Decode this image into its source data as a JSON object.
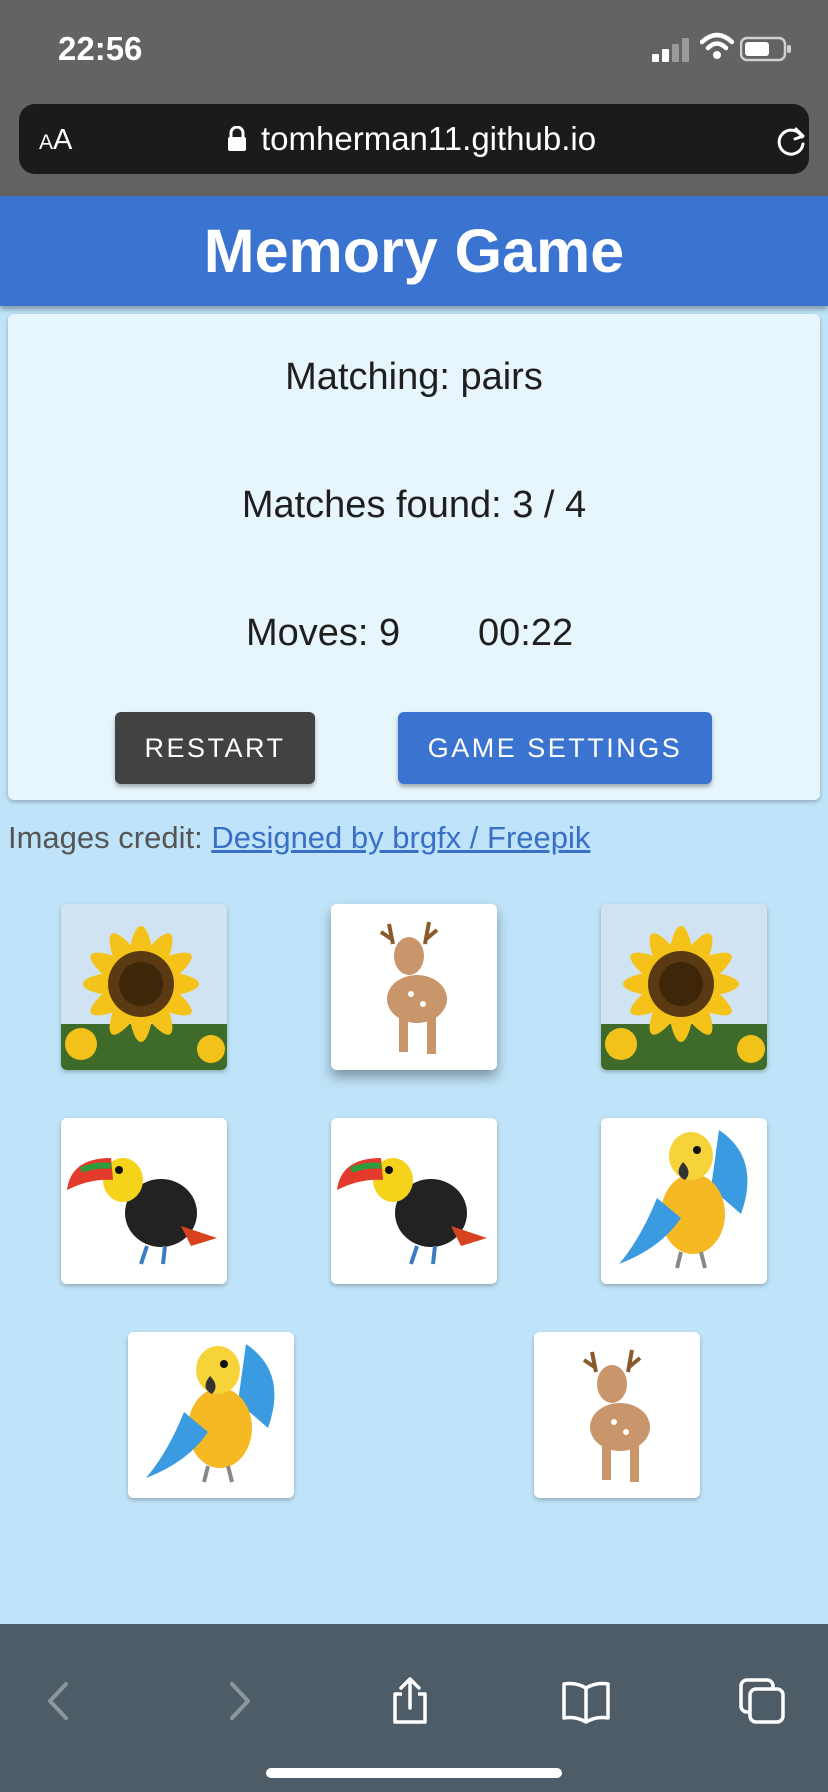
{
  "status": {
    "time": "22:56"
  },
  "browser": {
    "aa_small": "A",
    "aa_big": "A",
    "url": "tomherman11.github.io"
  },
  "header": {
    "title": "Memory Game"
  },
  "panel": {
    "matching": "Matching: pairs",
    "matches": "Matches found: 3 / 4",
    "moves": "Moves: 9",
    "timer": "00:22",
    "restart_label": "RESTART",
    "settings_label": "GAME SETTINGS"
  },
  "credit": {
    "prefix": "Images credit: ",
    "link_text": "Designed by brgfx / Freepik"
  },
  "cards": [
    {
      "image": "sunflower"
    },
    {
      "image": "deer"
    },
    {
      "image": "sunflower"
    },
    {
      "image": "toucan"
    },
    {
      "image": "toucan"
    },
    {
      "image": "parrot"
    },
    {
      "image": "parrot"
    },
    {
      "image": "deer"
    }
  ],
  "toolbar": [
    "back-icon",
    "forward-icon",
    "share-icon",
    "bookmarks-icon",
    "tabs-icon"
  ],
  "colors": {
    "header": "#3a74d0",
    "background": "#bfe3f8",
    "panel": "#e7f5fc",
    "restart": "#424242"
  }
}
